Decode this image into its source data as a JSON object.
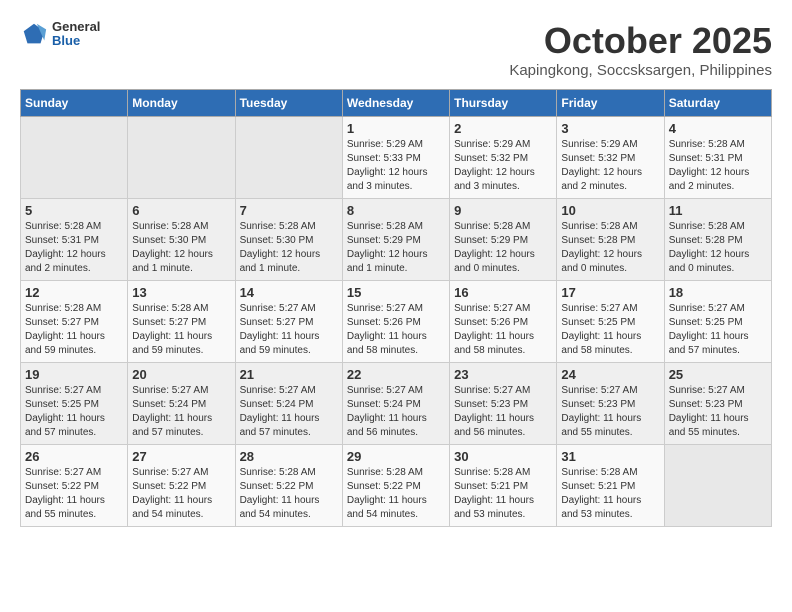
{
  "header": {
    "logo_general": "General",
    "logo_blue": "Blue",
    "month": "October 2025",
    "location": "Kapingkong, Soccsksargen, Philippines"
  },
  "weekdays": [
    "Sunday",
    "Monday",
    "Tuesday",
    "Wednesday",
    "Thursday",
    "Friday",
    "Saturday"
  ],
  "weeks": [
    [
      {
        "day": "",
        "sunrise": "",
        "sunset": "",
        "daylight": ""
      },
      {
        "day": "",
        "sunrise": "",
        "sunset": "",
        "daylight": ""
      },
      {
        "day": "",
        "sunrise": "",
        "sunset": "",
        "daylight": ""
      },
      {
        "day": "1",
        "sunrise": "Sunrise: 5:29 AM",
        "sunset": "Sunset: 5:33 PM",
        "daylight": "Daylight: 12 hours and 3 minutes."
      },
      {
        "day": "2",
        "sunrise": "Sunrise: 5:29 AM",
        "sunset": "Sunset: 5:32 PM",
        "daylight": "Daylight: 12 hours and 3 minutes."
      },
      {
        "day": "3",
        "sunrise": "Sunrise: 5:29 AM",
        "sunset": "Sunset: 5:32 PM",
        "daylight": "Daylight: 12 hours and 2 minutes."
      },
      {
        "day": "4",
        "sunrise": "Sunrise: 5:28 AM",
        "sunset": "Sunset: 5:31 PM",
        "daylight": "Daylight: 12 hours and 2 minutes."
      }
    ],
    [
      {
        "day": "5",
        "sunrise": "Sunrise: 5:28 AM",
        "sunset": "Sunset: 5:31 PM",
        "daylight": "Daylight: 12 hours and 2 minutes."
      },
      {
        "day": "6",
        "sunrise": "Sunrise: 5:28 AM",
        "sunset": "Sunset: 5:30 PM",
        "daylight": "Daylight: 12 hours and 1 minute."
      },
      {
        "day": "7",
        "sunrise": "Sunrise: 5:28 AM",
        "sunset": "Sunset: 5:30 PM",
        "daylight": "Daylight: 12 hours and 1 minute."
      },
      {
        "day": "8",
        "sunrise": "Sunrise: 5:28 AM",
        "sunset": "Sunset: 5:29 PM",
        "daylight": "Daylight: 12 hours and 1 minute."
      },
      {
        "day": "9",
        "sunrise": "Sunrise: 5:28 AM",
        "sunset": "Sunset: 5:29 PM",
        "daylight": "Daylight: 12 hours and 0 minutes."
      },
      {
        "day": "10",
        "sunrise": "Sunrise: 5:28 AM",
        "sunset": "Sunset: 5:28 PM",
        "daylight": "Daylight: 12 hours and 0 minutes."
      },
      {
        "day": "11",
        "sunrise": "Sunrise: 5:28 AM",
        "sunset": "Sunset: 5:28 PM",
        "daylight": "Daylight: 12 hours and 0 minutes."
      }
    ],
    [
      {
        "day": "12",
        "sunrise": "Sunrise: 5:28 AM",
        "sunset": "Sunset: 5:27 PM",
        "daylight": "Daylight: 11 hours and 59 minutes."
      },
      {
        "day": "13",
        "sunrise": "Sunrise: 5:28 AM",
        "sunset": "Sunset: 5:27 PM",
        "daylight": "Daylight: 11 hours and 59 minutes."
      },
      {
        "day": "14",
        "sunrise": "Sunrise: 5:27 AM",
        "sunset": "Sunset: 5:27 PM",
        "daylight": "Daylight: 11 hours and 59 minutes."
      },
      {
        "day": "15",
        "sunrise": "Sunrise: 5:27 AM",
        "sunset": "Sunset: 5:26 PM",
        "daylight": "Daylight: 11 hours and 58 minutes."
      },
      {
        "day": "16",
        "sunrise": "Sunrise: 5:27 AM",
        "sunset": "Sunset: 5:26 PM",
        "daylight": "Daylight: 11 hours and 58 minutes."
      },
      {
        "day": "17",
        "sunrise": "Sunrise: 5:27 AM",
        "sunset": "Sunset: 5:25 PM",
        "daylight": "Daylight: 11 hours and 58 minutes."
      },
      {
        "day": "18",
        "sunrise": "Sunrise: 5:27 AM",
        "sunset": "Sunset: 5:25 PM",
        "daylight": "Daylight: 11 hours and 57 minutes."
      }
    ],
    [
      {
        "day": "19",
        "sunrise": "Sunrise: 5:27 AM",
        "sunset": "Sunset: 5:25 PM",
        "daylight": "Daylight: 11 hours and 57 minutes."
      },
      {
        "day": "20",
        "sunrise": "Sunrise: 5:27 AM",
        "sunset": "Sunset: 5:24 PM",
        "daylight": "Daylight: 11 hours and 57 minutes."
      },
      {
        "day": "21",
        "sunrise": "Sunrise: 5:27 AM",
        "sunset": "Sunset: 5:24 PM",
        "daylight": "Daylight: 11 hours and 57 minutes."
      },
      {
        "day": "22",
        "sunrise": "Sunrise: 5:27 AM",
        "sunset": "Sunset: 5:24 PM",
        "daylight": "Daylight: 11 hours and 56 minutes."
      },
      {
        "day": "23",
        "sunrise": "Sunrise: 5:27 AM",
        "sunset": "Sunset: 5:23 PM",
        "daylight": "Daylight: 11 hours and 56 minutes."
      },
      {
        "day": "24",
        "sunrise": "Sunrise: 5:27 AM",
        "sunset": "Sunset: 5:23 PM",
        "daylight": "Daylight: 11 hours and 55 minutes."
      },
      {
        "day": "25",
        "sunrise": "Sunrise: 5:27 AM",
        "sunset": "Sunset: 5:23 PM",
        "daylight": "Daylight: 11 hours and 55 minutes."
      }
    ],
    [
      {
        "day": "26",
        "sunrise": "Sunrise: 5:27 AM",
        "sunset": "Sunset: 5:22 PM",
        "daylight": "Daylight: 11 hours and 55 minutes."
      },
      {
        "day": "27",
        "sunrise": "Sunrise: 5:27 AM",
        "sunset": "Sunset: 5:22 PM",
        "daylight": "Daylight: 11 hours and 54 minutes."
      },
      {
        "day": "28",
        "sunrise": "Sunrise: 5:28 AM",
        "sunset": "Sunset: 5:22 PM",
        "daylight": "Daylight: 11 hours and 54 minutes."
      },
      {
        "day": "29",
        "sunrise": "Sunrise: 5:28 AM",
        "sunset": "Sunset: 5:22 PM",
        "daylight": "Daylight: 11 hours and 54 minutes."
      },
      {
        "day": "30",
        "sunrise": "Sunrise: 5:28 AM",
        "sunset": "Sunset: 5:21 PM",
        "daylight": "Daylight: 11 hours and 53 minutes."
      },
      {
        "day": "31",
        "sunrise": "Sunrise: 5:28 AM",
        "sunset": "Sunset: 5:21 PM",
        "daylight": "Daylight: 11 hours and 53 minutes."
      },
      {
        "day": "",
        "sunrise": "",
        "sunset": "",
        "daylight": ""
      }
    ]
  ]
}
